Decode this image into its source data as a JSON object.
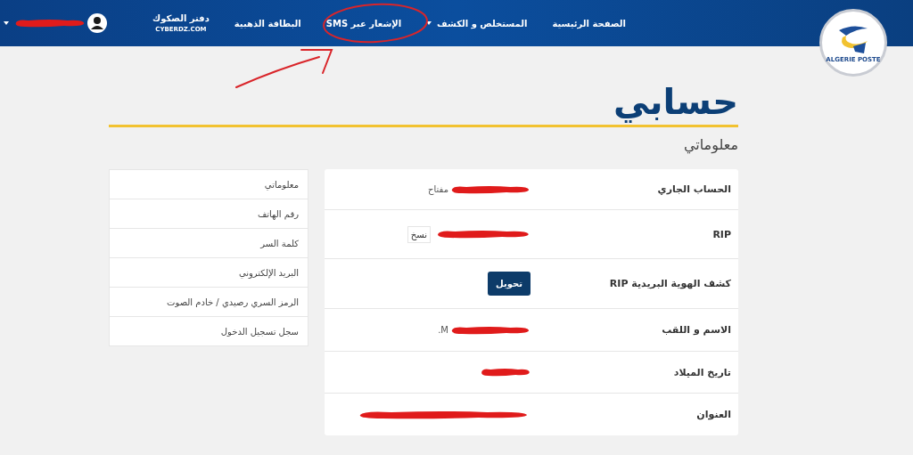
{
  "header": {
    "logo_text": "ALGERIE POSTE",
    "nav": [
      {
        "label": "الصفحة الرئيسية",
        "dropdown": false
      },
      {
        "label": "المستخلص و الكشف",
        "dropdown": true
      },
      {
        "label": "الإشعار عبر SMS",
        "dropdown": false
      },
      {
        "label": "البطاقة الذهبية",
        "dropdown": false
      },
      {
        "label": "دفتر الصكوك",
        "subtitle": "CYBERDZ.COM",
        "dropdown": false
      }
    ],
    "account": {
      "redacted": true,
      "dropdown": true
    }
  },
  "page_title": "حسابي",
  "section_title": "معلوماتي",
  "side_menu": [
    "معلوماتي",
    "رقم الهاتف",
    "كلمة السر",
    "البريد الإلكتروني",
    "الرمز السري رصيدي / خادم الصوت",
    "سجل تسجيل الدخول"
  ],
  "info_rows": [
    {
      "label": "الحساب الجاري",
      "kind": "text",
      "value": "مفتاح",
      "redacted": true
    },
    {
      "label": "RIP",
      "kind": "copy",
      "button": "نسخ",
      "redacted": true
    },
    {
      "label": "كشف الهوية البريدية RIP",
      "kind": "button",
      "button": "تحويل",
      "redacted": false
    },
    {
      "label": "الاسم و اللقب",
      "kind": "text",
      "value": "M.",
      "redacted": true
    },
    {
      "label": "تاريخ الميلاد",
      "kind": "text",
      "redacted": true
    },
    {
      "label": "العنوان",
      "kind": "text",
      "redacted": true
    }
  ]
}
